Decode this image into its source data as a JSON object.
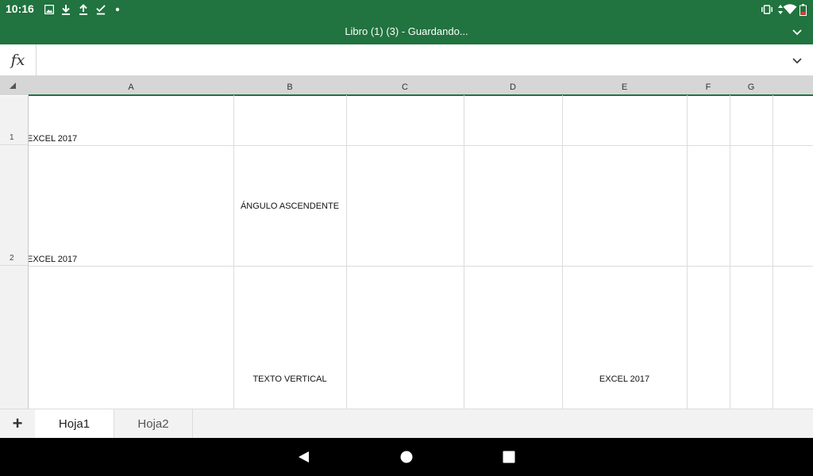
{
  "status_bar": {
    "time": "10:16",
    "icons": [
      "image-icon",
      "download-icon",
      "upload-icon",
      "check-icon",
      "dot-icon",
      "vibrate-icon",
      "data-icon",
      "wifi-icon",
      "battery-low-icon"
    ]
  },
  "title_bar": {
    "title": "Libro (1) (3) - Guardando..."
  },
  "formula_bar": {
    "fx_label": "fx",
    "value": ""
  },
  "columns": [
    "A",
    "B",
    "C",
    "D",
    "E",
    "F",
    "G"
  ],
  "rows": [
    "1",
    "2"
  ],
  "cells": {
    "a1": "EXCEL 2017",
    "a2": "EXCEL 2017",
    "b2": "ÁNGULO ASCENDENTE",
    "b3": "TEXTO VERTICAL",
    "e3": "EXCEL 2017"
  },
  "sheets": {
    "add_label": "+",
    "tabs": [
      "Hoja1",
      "Hoja2"
    ],
    "active": "Hoja1"
  },
  "colors": {
    "accent": "#21733f",
    "header_bg": "#d6d6d6",
    "nav_bg": "#000000"
  }
}
